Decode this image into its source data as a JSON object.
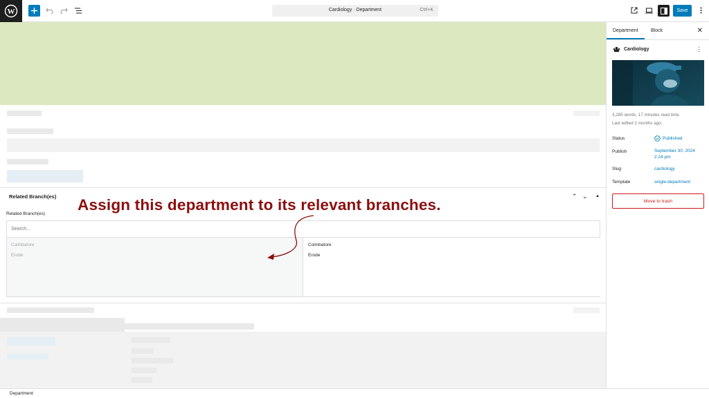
{
  "toolbar": {
    "command_title": "Cardiology · Department",
    "command_shortcut": "Ctrl+K",
    "save_label": "Save"
  },
  "editor": {
    "related_branches": {
      "title": "Related Branch(es)",
      "field_label": "Related Branch(es)",
      "search_placeholder": "Search...",
      "available": [
        "Coimbatore",
        "Erode"
      ],
      "selected": [
        "Coimbatore",
        "Erode"
      ]
    },
    "annotation": "Assign this department to its relevant branches."
  },
  "footer": {
    "breadcrumb": "Department"
  },
  "sidebar": {
    "tabs": [
      "Department",
      "Block"
    ],
    "active_tab": "Department",
    "post_title": "Cardiology",
    "meta_words": "3,285 words, 17 minutes read time.",
    "meta_edited": "Last edited 2 months ago.",
    "status_label": "Status",
    "status_value": "Published",
    "publish_label": "Publish",
    "publish_value": "September 30, 2024 2:24 pm",
    "slug_label": "Slug",
    "slug_value": "cardiology",
    "template_label": "Template",
    "template_value": "single-department",
    "trash_label": "Move to trash"
  },
  "colors": {
    "accent": "#007cba",
    "hero": "#dce8c0",
    "annotation": "#8b0e0e",
    "danger": "#cc1818"
  }
}
